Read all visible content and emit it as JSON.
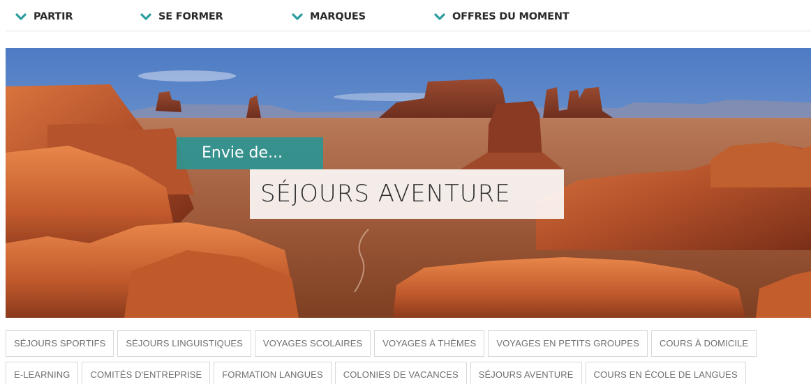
{
  "nav": {
    "items": [
      {
        "label": "PARTIR"
      },
      {
        "label": "SE FORMER"
      },
      {
        "label": "MARQUES"
      },
      {
        "label": "OFFRES DU MOMENT"
      }
    ],
    "accent_color": "#2a9d9f"
  },
  "hero": {
    "kicker": "Envie de...",
    "headline": "SÉJOURS AVENTURE",
    "kicker_bg": "#269696",
    "image_subject": "desert-canyon-landscape"
  },
  "tags": {
    "row1": [
      "SÉJOURS SPORTIFS",
      "SÉJOURS LINGUISTIQUES",
      "VOYAGES SCOLAIRES",
      "VOYAGES À THÈMES",
      "VOYAGES EN PETITS GROUPES",
      "COURS À DOMICILE"
    ],
    "row2": [
      "E-LEARNING",
      "COMITÉS D'ENTREPRISE",
      "FORMATION LANGUES",
      "COLONIES DE VACANCES",
      "SÉJOURS AVENTURE",
      "COURS EN ÉCOLE DE LANGUES"
    ]
  }
}
